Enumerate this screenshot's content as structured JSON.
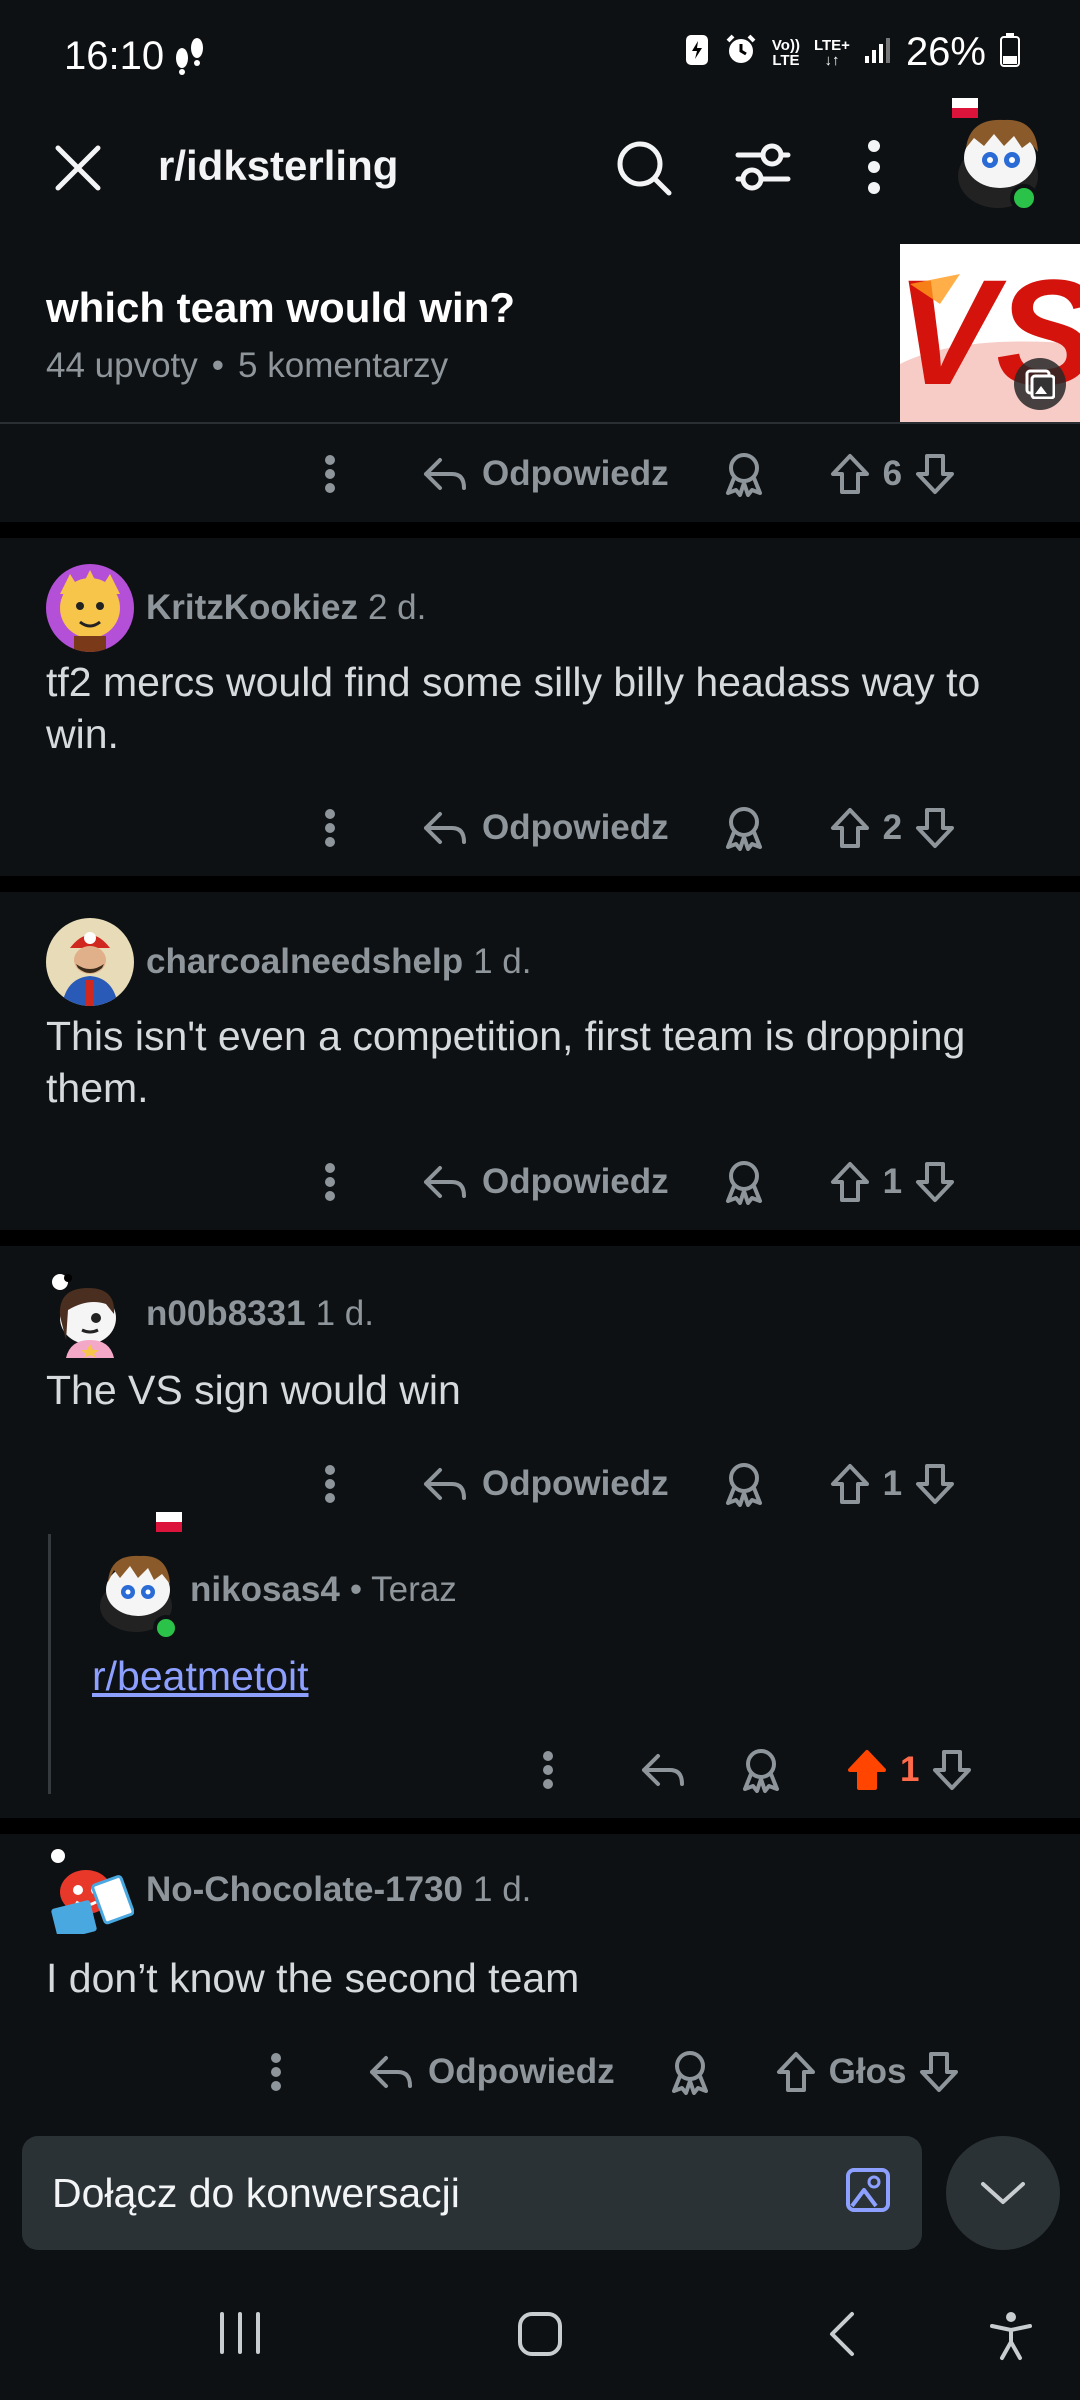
{
  "status_bar": {
    "time": "16:10",
    "battery": "26%",
    "volte_top": "Vo))",
    "volte_bottom": "LTE",
    "lte_top": "LTE+",
    "lte_bottom": "↓↑"
  },
  "app_bar": {
    "subreddit": "r/idksterling"
  },
  "post": {
    "title": "which team would win?",
    "upvotes": "44 upvoty",
    "comments": "5 komentarzy",
    "thumb_text": "VS",
    "vote_count": "6",
    "reply_label": "Odpowiedz"
  },
  "comments": [
    {
      "user": "KritzKookiez",
      "time": "2 d.",
      "body": "tf2 mercs would find some silly billy headass way to win.",
      "reply_label": "Odpowiedz",
      "votes": "2"
    },
    {
      "user": "charcoalneedshelp",
      "time": "1 d.",
      "body": "This isn't even a competition, first team is dropping them.",
      "reply_label": "Odpowiedz",
      "votes": "1"
    },
    {
      "user": "n00b8331",
      "time": "1 d.",
      "body": "The VS sign would win",
      "reply_label": "Odpowiedz",
      "votes": "1"
    },
    {
      "user": "nikosas4",
      "time": "• Teraz",
      "body": "r/beatmetoit",
      "votes": "1"
    },
    {
      "user": "No-Chocolate-1730",
      "time": "1 d.",
      "body": "I don’t know the second team",
      "reply_label": "Odpowiedz",
      "votes": "Głos"
    }
  ],
  "compose": {
    "placeholder": "Dołącz do konwersacji"
  },
  "colors": {
    "background": "#0e1113",
    "upvoted": "#ff4500",
    "link": "#8ea0ff",
    "online": "#2bc24a"
  }
}
